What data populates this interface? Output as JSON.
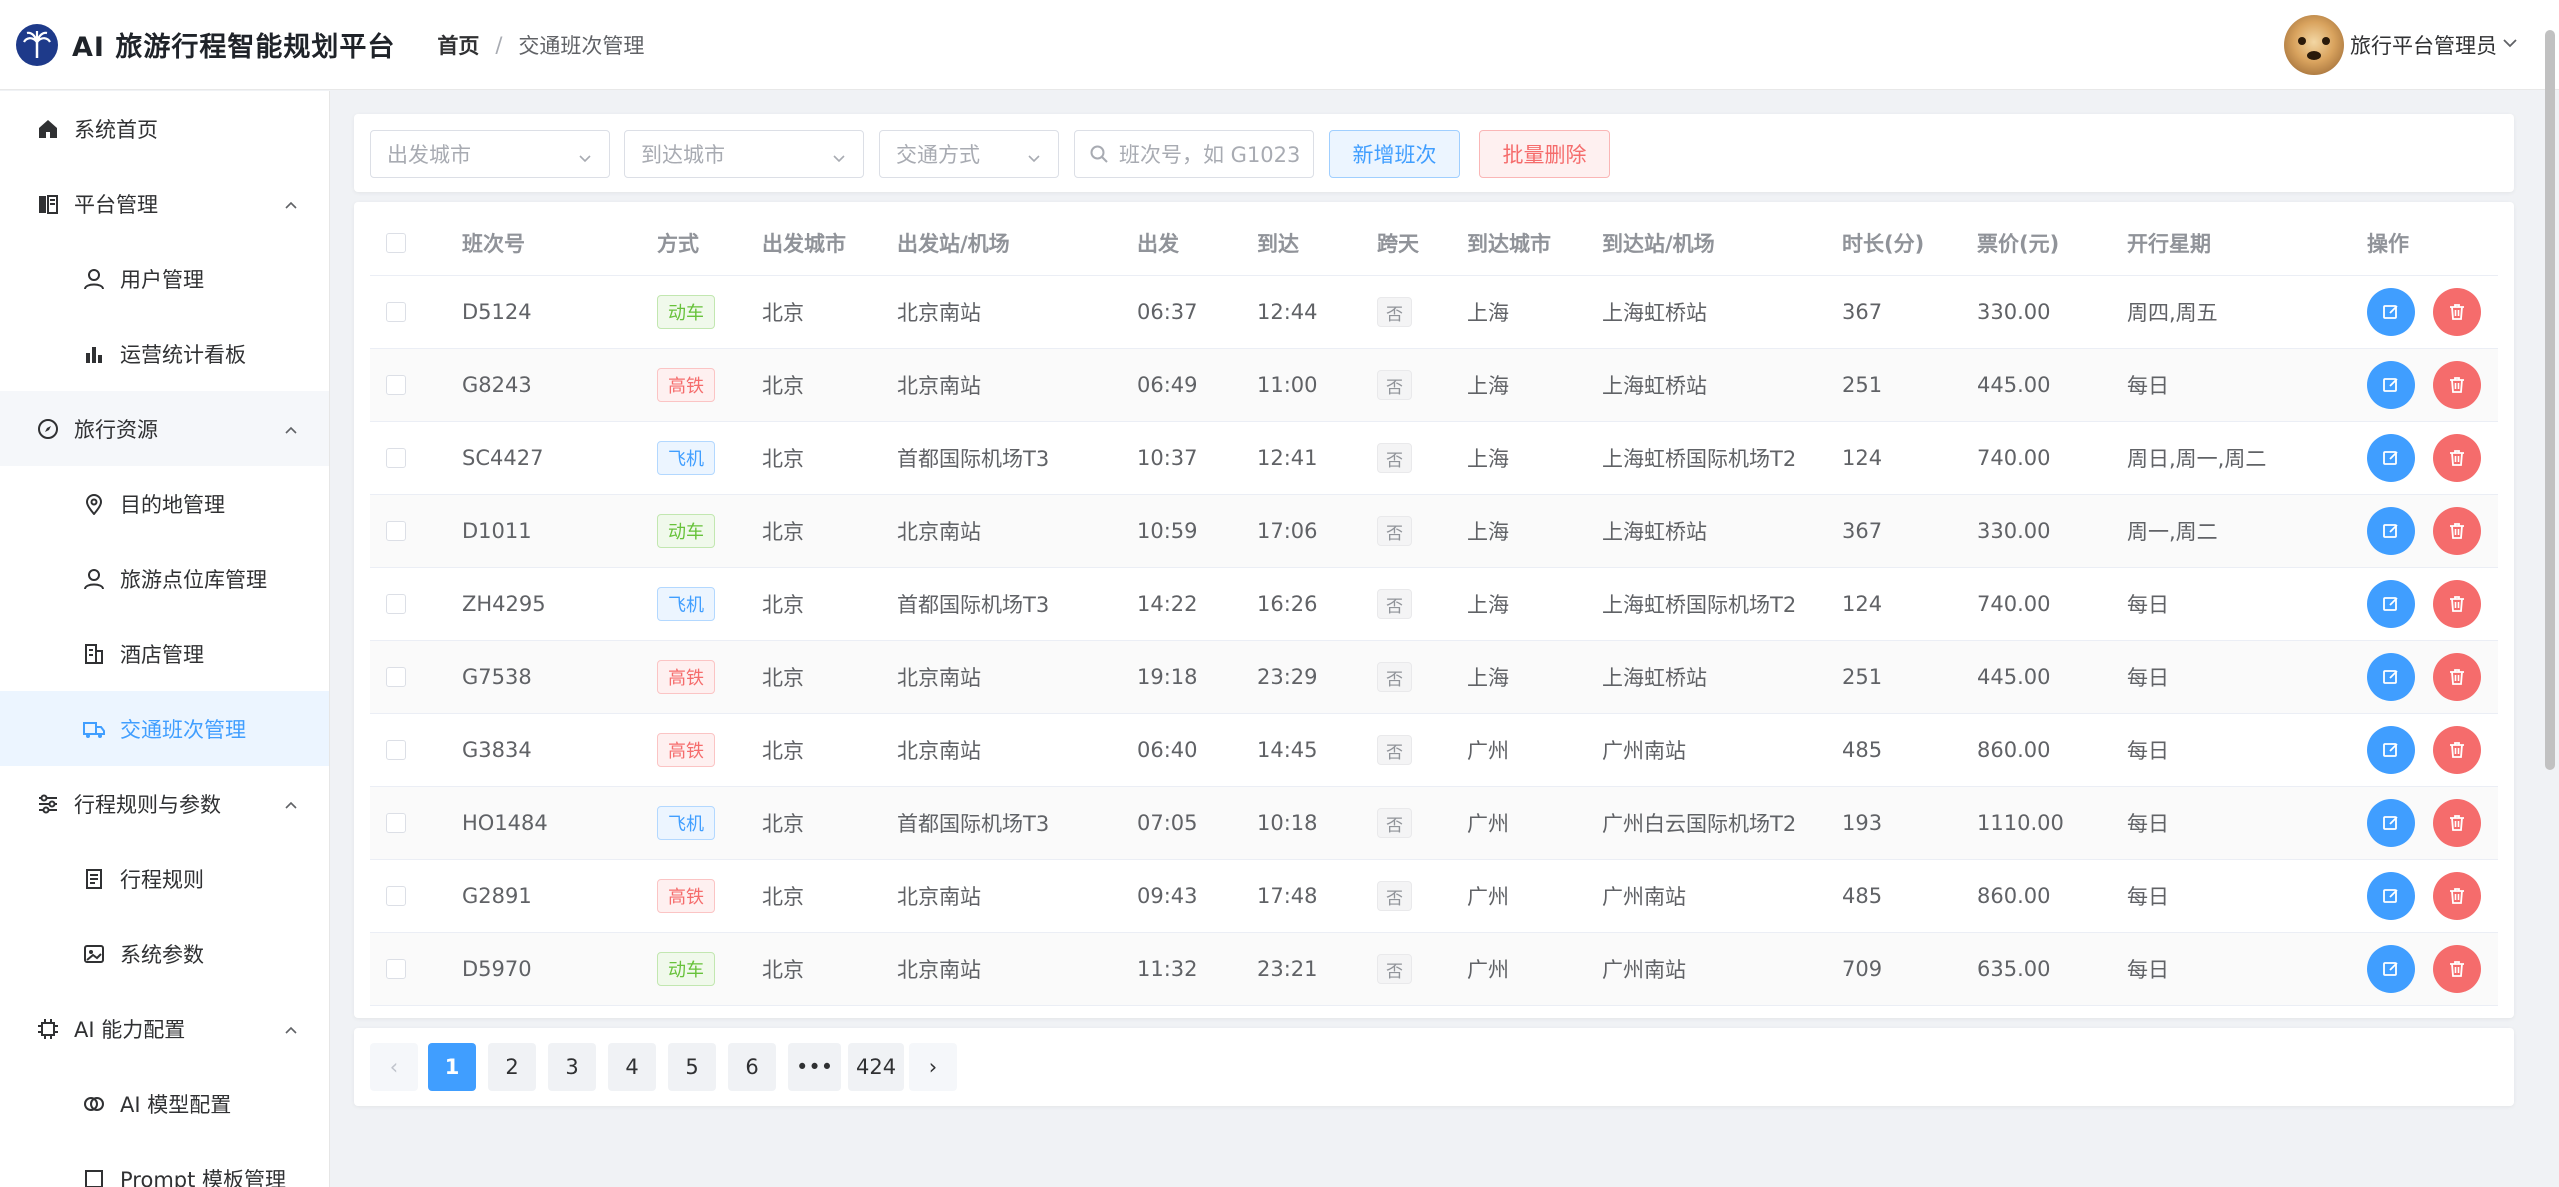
{
  "app": {
    "title": "AI 旅游行程智能规划平台"
  },
  "breadcrumb": {
    "home": "首页",
    "separator": "/",
    "current": "交通班次管理"
  },
  "user": {
    "name": "旅行平台管理员"
  },
  "sidebar": {
    "items": [
      {
        "label": "系统首页",
        "icon": "home-icon",
        "level": "top"
      },
      {
        "label": "平台管理",
        "icon": "building-icon",
        "level": "top",
        "expanded": true
      },
      {
        "label": "用户管理",
        "icon": "user-icon",
        "level": "sub"
      },
      {
        "label": "运营统计看板",
        "icon": "bar-chart-icon",
        "level": "sub"
      },
      {
        "label": "旅行资源",
        "icon": "compass-icon",
        "level": "top",
        "expanded": true
      },
      {
        "label": "目的地管理",
        "icon": "location-icon",
        "level": "sub"
      },
      {
        "label": "旅游点位库管理",
        "icon": "user-pin-icon",
        "level": "sub"
      },
      {
        "label": "酒店管理",
        "icon": "hotel-icon",
        "level": "sub"
      },
      {
        "label": "交通班次管理",
        "icon": "truck-icon",
        "level": "sub",
        "active": true
      },
      {
        "label": "行程规则与参数",
        "icon": "sliders-icon",
        "level": "top",
        "expanded": true
      },
      {
        "label": "行程规则",
        "icon": "document-icon",
        "level": "sub"
      },
      {
        "label": "系统参数",
        "icon": "image-settings-icon",
        "level": "sub"
      },
      {
        "label": "AI 能力配置",
        "icon": "cpu-icon",
        "level": "top",
        "expanded": true
      },
      {
        "label": "AI 模型配置",
        "icon": "model-icon",
        "level": "sub"
      },
      {
        "label": "Prompt 模板管理",
        "icon": "template-icon",
        "level": "sub"
      }
    ]
  },
  "filters": {
    "departure_placeholder": "出发城市",
    "arrival_placeholder": "到达城市",
    "mode_placeholder": "交通方式",
    "search_placeholder": "班次号，如 G1023",
    "add_label": "新增班次",
    "batch_delete_label": "批量删除"
  },
  "table": {
    "columns": [
      "班次号",
      "方式",
      "出发城市",
      "出发站/机场",
      "出发",
      "到达",
      "跨天",
      "到达城市",
      "到达站/机场",
      "时长(分)",
      "票价(元)",
      "开行星期",
      "操作"
    ],
    "rows": [
      {
        "no": "D5124",
        "mode": "动车",
        "mode_type": "dong",
        "from_city": "北京",
        "from_station": "北京南站",
        "dep": "06:37",
        "arr": "12:44",
        "overnight": "否",
        "to_city": "上海",
        "to_station": "上海虹桥站",
        "duration": "367",
        "price": "330.00",
        "days": "周四,周五"
      },
      {
        "no": "G8243",
        "mode": "高铁",
        "mode_type": "gao",
        "from_city": "北京",
        "from_station": "北京南站",
        "dep": "06:49",
        "arr": "11:00",
        "overnight": "否",
        "to_city": "上海",
        "to_station": "上海虹桥站",
        "duration": "251",
        "price": "445.00",
        "days": "每日"
      },
      {
        "no": "SC4427",
        "mode": "飞机",
        "mode_type": "fei",
        "from_city": "北京",
        "from_station": "首都国际机场T3",
        "dep": "10:37",
        "arr": "12:41",
        "overnight": "否",
        "to_city": "上海",
        "to_station": "上海虹桥国际机场T2",
        "duration": "124",
        "price": "740.00",
        "days": "周日,周一,周二"
      },
      {
        "no": "D1011",
        "mode": "动车",
        "mode_type": "dong",
        "from_city": "北京",
        "from_station": "北京南站",
        "dep": "10:59",
        "arr": "17:06",
        "overnight": "否",
        "to_city": "上海",
        "to_station": "上海虹桥站",
        "duration": "367",
        "price": "330.00",
        "days": "周一,周二"
      },
      {
        "no": "ZH4295",
        "mode": "飞机",
        "mode_type": "fei",
        "from_city": "北京",
        "from_station": "首都国际机场T3",
        "dep": "14:22",
        "arr": "16:26",
        "overnight": "否",
        "to_city": "上海",
        "to_station": "上海虹桥国际机场T2",
        "duration": "124",
        "price": "740.00",
        "days": "每日"
      },
      {
        "no": "G7538",
        "mode": "高铁",
        "mode_type": "gao",
        "from_city": "北京",
        "from_station": "北京南站",
        "dep": "19:18",
        "arr": "23:29",
        "overnight": "否",
        "to_city": "上海",
        "to_station": "上海虹桥站",
        "duration": "251",
        "price": "445.00",
        "days": "每日"
      },
      {
        "no": "G3834",
        "mode": "高铁",
        "mode_type": "gao",
        "from_city": "北京",
        "from_station": "北京南站",
        "dep": "06:40",
        "arr": "14:45",
        "overnight": "否",
        "to_city": "广州",
        "to_station": "广州南站",
        "duration": "485",
        "price": "860.00",
        "days": "每日"
      },
      {
        "no": "HO1484",
        "mode": "飞机",
        "mode_type": "fei",
        "from_city": "北京",
        "from_station": "首都国际机场T3",
        "dep": "07:05",
        "arr": "10:18",
        "overnight": "否",
        "to_city": "广州",
        "to_station": "广州白云国际机场T2",
        "duration": "193",
        "price": "1110.00",
        "days": "每日"
      },
      {
        "no": "G2891",
        "mode": "高铁",
        "mode_type": "gao",
        "from_city": "北京",
        "from_station": "北京南站",
        "dep": "09:43",
        "arr": "17:48",
        "overnight": "否",
        "to_city": "广州",
        "to_station": "广州南站",
        "duration": "485",
        "price": "860.00",
        "days": "每日"
      },
      {
        "no": "D5970",
        "mode": "动车",
        "mode_type": "dong",
        "from_city": "北京",
        "from_station": "北京南站",
        "dep": "11:32",
        "arr": "23:21",
        "overnight": "否",
        "to_city": "广州",
        "to_station": "广州南站",
        "duration": "709",
        "price": "635.00",
        "days": "每日"
      }
    ]
  },
  "pagination": {
    "prev": "‹",
    "pages": [
      "1",
      "2",
      "3",
      "4",
      "5",
      "6",
      "•••",
      "424"
    ],
    "current": "1",
    "next": "›"
  },
  "colors": {
    "primary": "#409eff",
    "danger": "#f56c6c",
    "success": "#67c23a"
  }
}
